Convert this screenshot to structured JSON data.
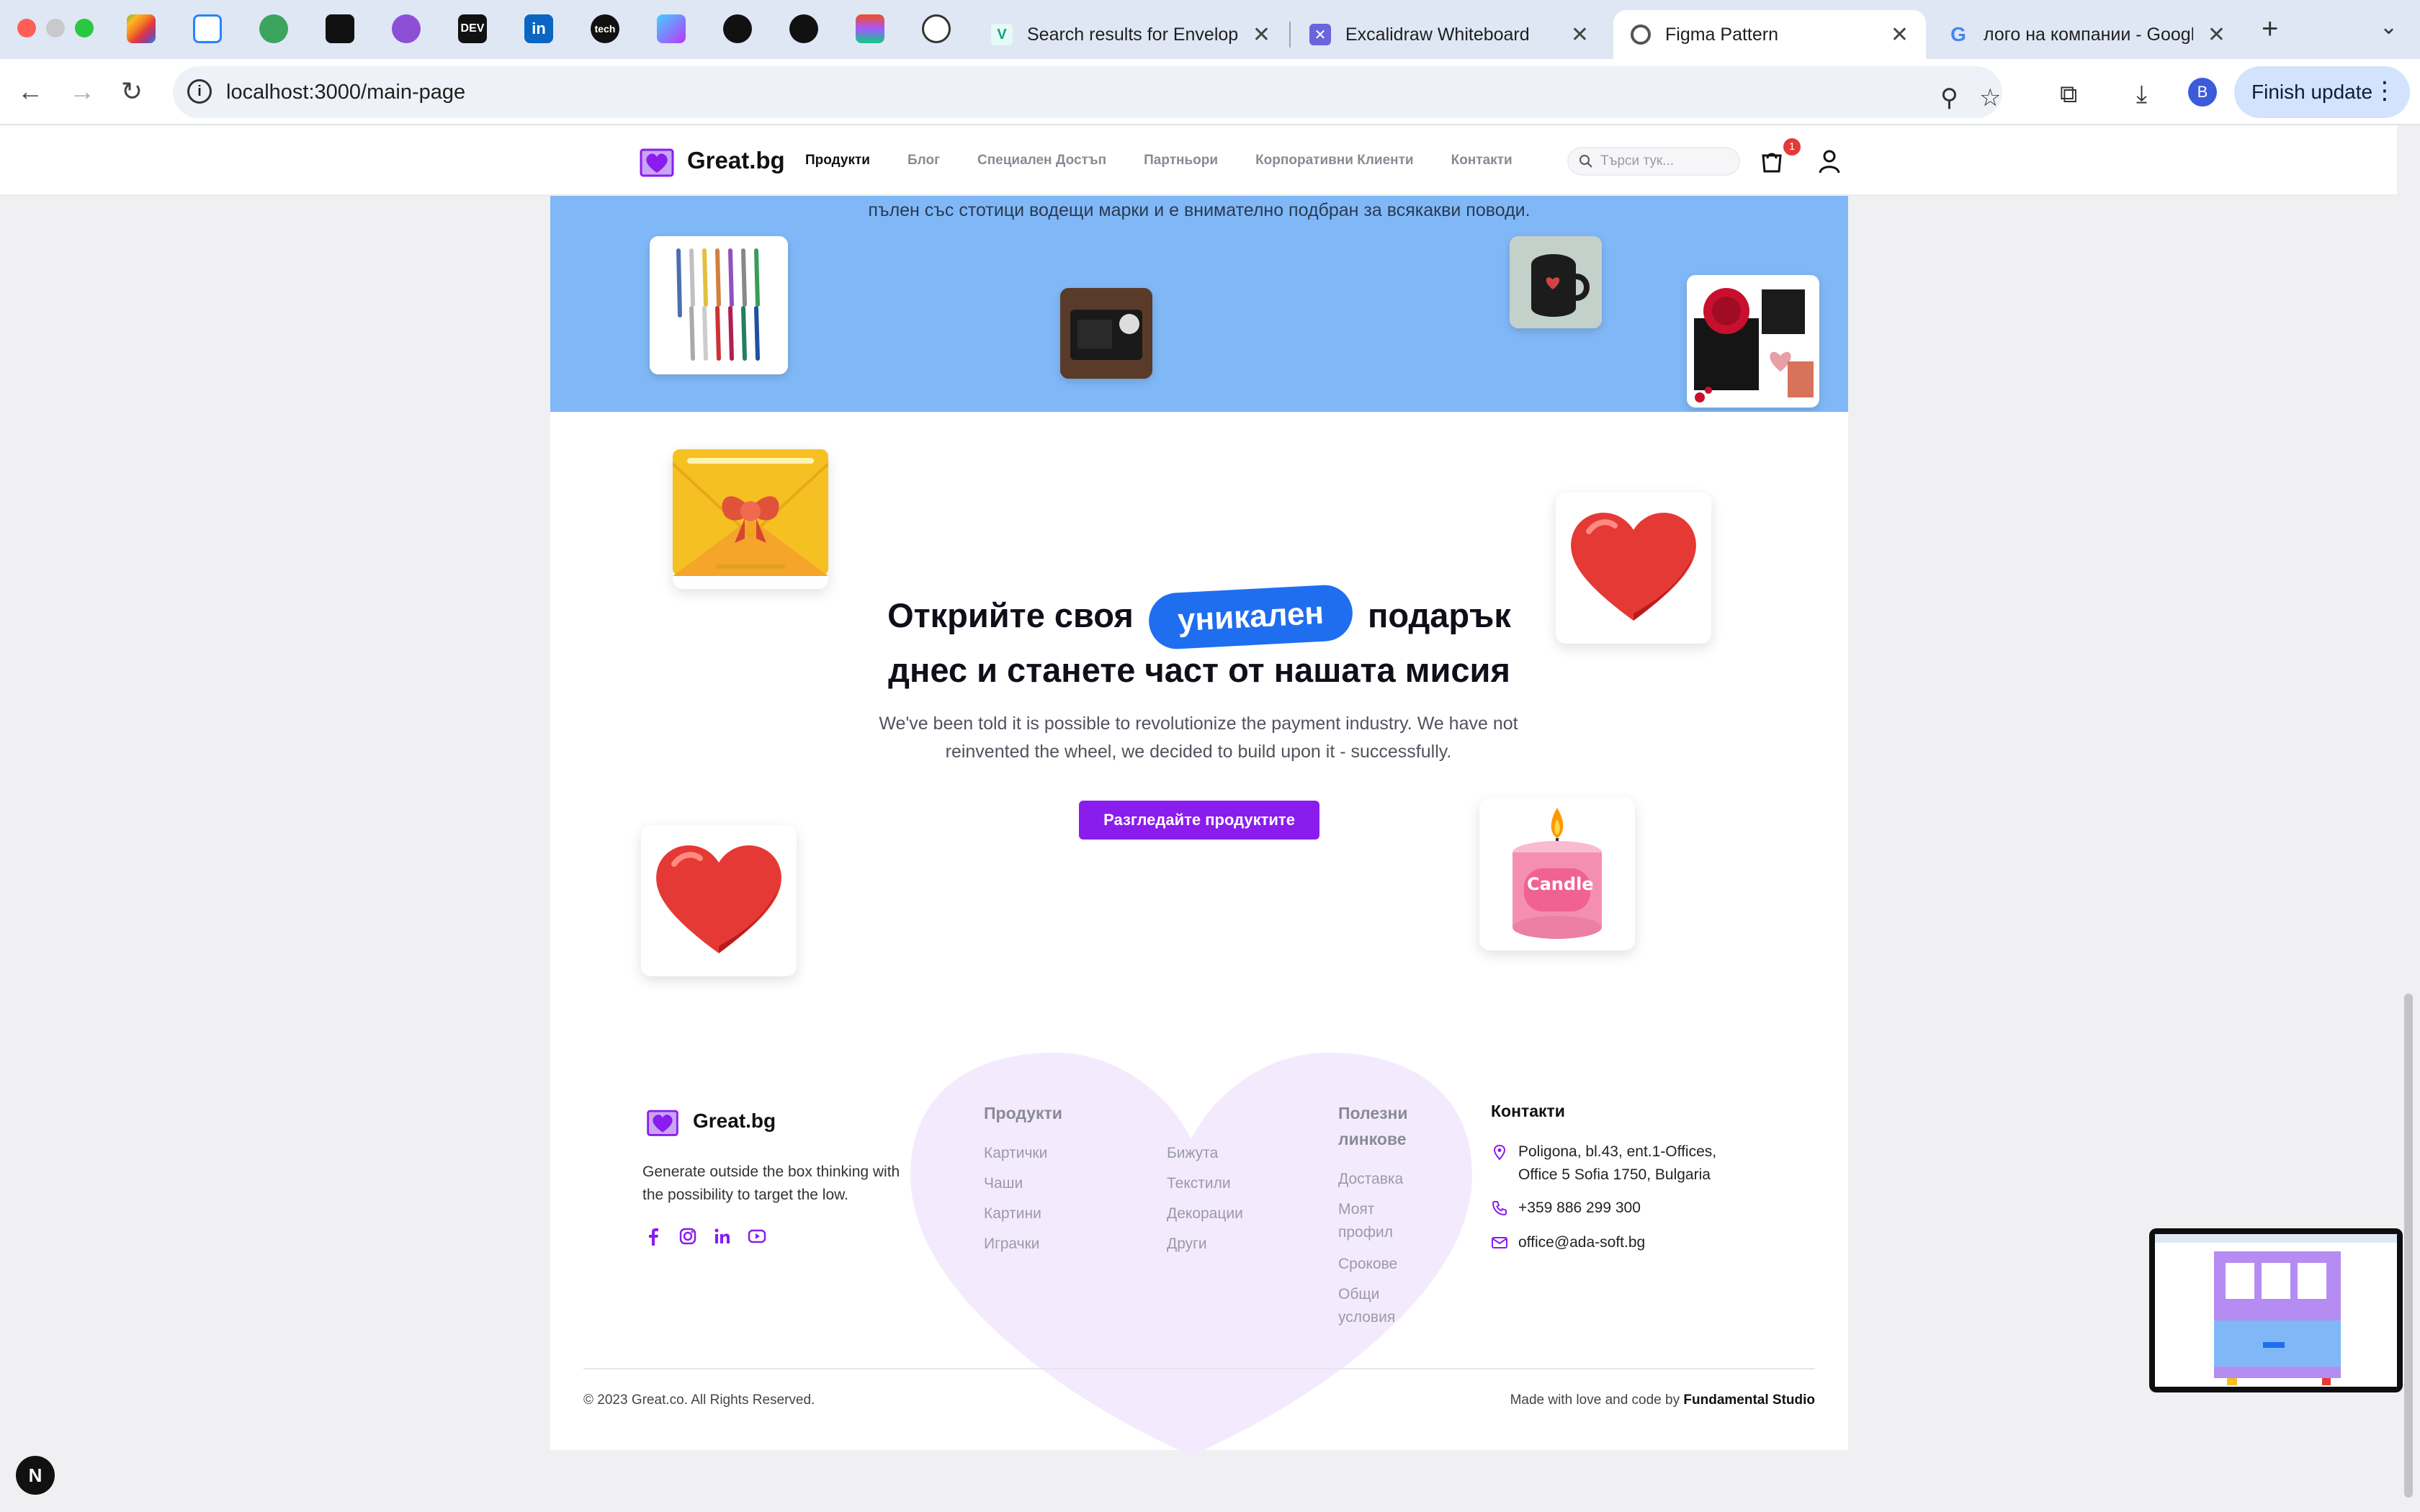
{
  "browser": {
    "tabs": [
      {
        "title": "Search results for Envelope",
        "close": "✕"
      },
      {
        "title": "Excalidraw Whiteboard",
        "close": "✕"
      },
      {
        "title": "Figma Pattern",
        "close": "✕"
      },
      {
        "title": "лого на компании - Google",
        "close": "✕"
      }
    ],
    "pinned": [
      "apple",
      "jira",
      "leetcode",
      "pinterest",
      "mastodon",
      "dev",
      "linkedin",
      "tech",
      "vite",
      "github",
      "mongodb",
      "figma",
      "openai"
    ],
    "pinned_labels": {
      "dev": "DEV",
      "linkedin": "in",
      "tech": "tech"
    },
    "new_tab": "+",
    "url": "localhost:3000/main-page",
    "profile_initial": "B",
    "finish_update": "Finish update"
  },
  "header": {
    "brand": "Great.bg",
    "nav": [
      "Продукти",
      "Блог",
      "Специален Достъп",
      "Партньори",
      "Корпоративни Клиенти",
      "Контакти"
    ],
    "search_placeholder": "Търси тук...",
    "cart_count": "1"
  },
  "hero_band": {
    "cut_text": "пълен със стотици водещи марки и е внимателно подбран за всякакви поводи."
  },
  "cta_section": {
    "headline_before": "Открийте своя",
    "headline_pill": "уникален",
    "headline_after": "подарък",
    "headline_line2": "днес и станете част от нашата мисия",
    "lead": "We've been told it is possible to revolutionize the payment industry. We have not reinvented the wheel, we decided to build upon it - successfully.",
    "button": "Разгледайте продуктите",
    "candle_label": "Candle"
  },
  "footer": {
    "brand": "Great.bg",
    "tagline": "Generate outside the box thinking with the possibility to target the low.",
    "products_title": "Продукти",
    "products_col1": [
      "Картички",
      "Чаши",
      "Картини",
      "Играчки"
    ],
    "products_col2": [
      "Бижута",
      "Текстили",
      "Декорации",
      "Други"
    ],
    "useful_title_1": "Полезни",
    "useful_title_2": "линкове",
    "useful": {
      "delivery": "Доставка",
      "profile_1": "Моят",
      "profile_2": "профил",
      "terms": "Срокове",
      "general_1": "Общи",
      "general_2": "условия"
    },
    "contacts_title": "Контакти",
    "address_1": "Poligona, bl.43, ent.1-Offices,",
    "address_2": "Office 5 Sofia 1750, Bulgaria",
    "phone": "+359 886 299 300",
    "email": "office@ada-soft.bg",
    "copyright": "© 2023 Great.co. All Rights Reserved.",
    "made_with": "Made with love and code by",
    "studio": "Fundamental Studio"
  },
  "overlay": {
    "next_badge": "N"
  },
  "colors": {
    "accent": "#8a1ced",
    "pill": "#1f6ef0",
    "band": "#80b8f7",
    "heart": "#e53935"
  }
}
